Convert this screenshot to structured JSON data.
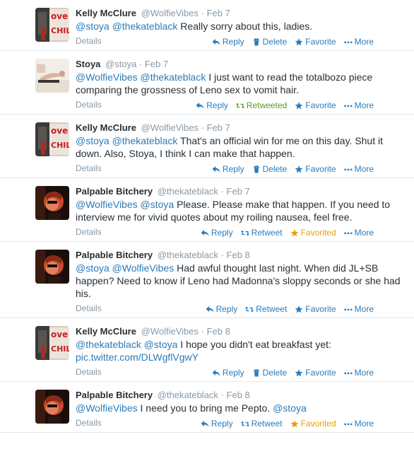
{
  "tweets": [
    {
      "name": "Kelly McClure",
      "handle": "@WolfieVibes",
      "sep": "·",
      "time": "Feb 7",
      "avatar": "avatar-kelly",
      "segments": [
        {
          "type": "mention",
          "text": "@stoya"
        },
        {
          "type": "text",
          "text": " "
        },
        {
          "type": "mention",
          "text": "@thekateblack"
        },
        {
          "type": "text",
          "text": " Really sorry about this, ladies."
        }
      ],
      "details": "Details",
      "actions": [
        {
          "icon": "reply-icon",
          "label": "Reply",
          "state": "normal"
        },
        {
          "icon": "trash-icon",
          "label": "Delete",
          "state": "normal"
        },
        {
          "icon": "star-icon",
          "label": "Favorite",
          "state": "normal"
        },
        {
          "icon": "more-icon",
          "label": "More",
          "state": "normal"
        }
      ]
    },
    {
      "name": "Stoya",
      "handle": "@stoya",
      "sep": "·",
      "time": "Feb 7",
      "avatar": "avatar-stoya",
      "segments": [
        {
          "type": "mention",
          "text": "@WolfieVibes"
        },
        {
          "type": "text",
          "text": " "
        },
        {
          "type": "mention",
          "text": "@thekateblack"
        },
        {
          "type": "text",
          "text": " I just want to read the totalbozo piece comparing the grossness of Leno sex to vomit hair."
        }
      ],
      "details": "Details",
      "actions": [
        {
          "icon": "reply-icon",
          "label": "Reply",
          "state": "normal"
        },
        {
          "icon": "retweet-icon",
          "label": "Retweeted",
          "state": "retweeted"
        },
        {
          "icon": "star-icon",
          "label": "Favorite",
          "state": "normal"
        },
        {
          "icon": "more-icon",
          "label": "More",
          "state": "normal"
        }
      ]
    },
    {
      "name": "Kelly McClure",
      "handle": "@WolfieVibes",
      "sep": "·",
      "time": "Feb 7",
      "avatar": "avatar-kelly",
      "segments": [
        {
          "type": "mention",
          "text": "@stoya"
        },
        {
          "type": "text",
          "text": " "
        },
        {
          "type": "mention",
          "text": "@thekateblack"
        },
        {
          "type": "text",
          "text": " That's an official win for me on this day. Shut it down. Also, Stoya, I think I can make that happen."
        }
      ],
      "details": "Details",
      "actions": [
        {
          "icon": "reply-icon",
          "label": "Reply",
          "state": "normal"
        },
        {
          "icon": "trash-icon",
          "label": "Delete",
          "state": "normal"
        },
        {
          "icon": "star-icon",
          "label": "Favorite",
          "state": "normal"
        },
        {
          "icon": "more-icon",
          "label": "More",
          "state": "normal"
        }
      ]
    },
    {
      "name": "Palpable Bitchery",
      "handle": "@thekateblack",
      "sep": "·",
      "time": "Feb 7",
      "avatar": "avatar-kate",
      "segments": [
        {
          "type": "mention",
          "text": "@WolfieVibes"
        },
        {
          "type": "text",
          "text": " "
        },
        {
          "type": "mention",
          "text": "@stoya"
        },
        {
          "type": "text",
          "text": " Please. Please make that happen. If you need to interview me for vivid quotes about my roiling nausea, feel free."
        }
      ],
      "details": "Details",
      "actions": [
        {
          "icon": "reply-icon",
          "label": "Reply",
          "state": "normal"
        },
        {
          "icon": "retweet-icon",
          "label": "Retweet",
          "state": "normal"
        },
        {
          "icon": "star-icon",
          "label": "Favorited",
          "state": "favorited"
        },
        {
          "icon": "more-icon",
          "label": "More",
          "state": "normal"
        }
      ]
    },
    {
      "name": "Palpable Bitchery",
      "handle": "@thekateblack",
      "sep": "·",
      "time": "Feb 8",
      "avatar": "avatar-kate",
      "segments": [
        {
          "type": "mention",
          "text": "@stoya"
        },
        {
          "type": "text",
          "text": " "
        },
        {
          "type": "mention",
          "text": "@WolfieVibes"
        },
        {
          "type": "text",
          "text": " Had awful thought last night. When did JL+SB happen? Need to know if Leno had Madonna's sloppy seconds or she had his."
        }
      ],
      "details": "Details",
      "actions": [
        {
          "icon": "reply-icon",
          "label": "Reply",
          "state": "normal"
        },
        {
          "icon": "retweet-icon",
          "label": "Retweet",
          "state": "normal"
        },
        {
          "icon": "star-icon",
          "label": "Favorite",
          "state": "normal"
        },
        {
          "icon": "more-icon",
          "label": "More",
          "state": "normal"
        }
      ]
    },
    {
      "name": "Kelly McClure",
      "handle": "@WolfieVibes",
      "sep": "·",
      "time": "Feb 8",
      "avatar": "avatar-kelly",
      "segments": [
        {
          "type": "mention",
          "text": "@thekateblack"
        },
        {
          "type": "text",
          "text": " "
        },
        {
          "type": "mention",
          "text": "@stoya"
        },
        {
          "type": "text",
          "text": " I hope you didn't eat breakfast yet: "
        },
        {
          "type": "link",
          "text": "pic.twitter.com/DLWgflVgwY"
        }
      ],
      "details": "Details",
      "actions": [
        {
          "icon": "reply-icon",
          "label": "Reply",
          "state": "normal"
        },
        {
          "icon": "trash-icon",
          "label": "Delete",
          "state": "normal"
        },
        {
          "icon": "star-icon",
          "label": "Favorite",
          "state": "normal"
        },
        {
          "icon": "more-icon",
          "label": "More",
          "state": "normal"
        }
      ]
    },
    {
      "name": "Palpable Bitchery",
      "handle": "@thekateblack",
      "sep": "·",
      "time": "Feb 8",
      "avatar": "avatar-kate",
      "segments": [
        {
          "type": "mention",
          "text": "@WolfieVibes"
        },
        {
          "type": "text",
          "text": " I need you to bring me Pepto. "
        },
        {
          "type": "mention",
          "text": "@stoya"
        }
      ],
      "details": "Details",
      "actions": [
        {
          "icon": "reply-icon",
          "label": "Reply",
          "state": "normal"
        },
        {
          "icon": "retweet-icon",
          "label": "Retweet",
          "state": "normal"
        },
        {
          "icon": "star-icon",
          "label": "Favorited",
          "state": "favorited"
        },
        {
          "icon": "more-icon",
          "label": "More",
          "state": "normal"
        }
      ]
    }
  ],
  "colors": {
    "link": "#2b7bb9",
    "muted": "#8899a6",
    "retweeted": "#609928",
    "favorited": "#e8a000"
  }
}
